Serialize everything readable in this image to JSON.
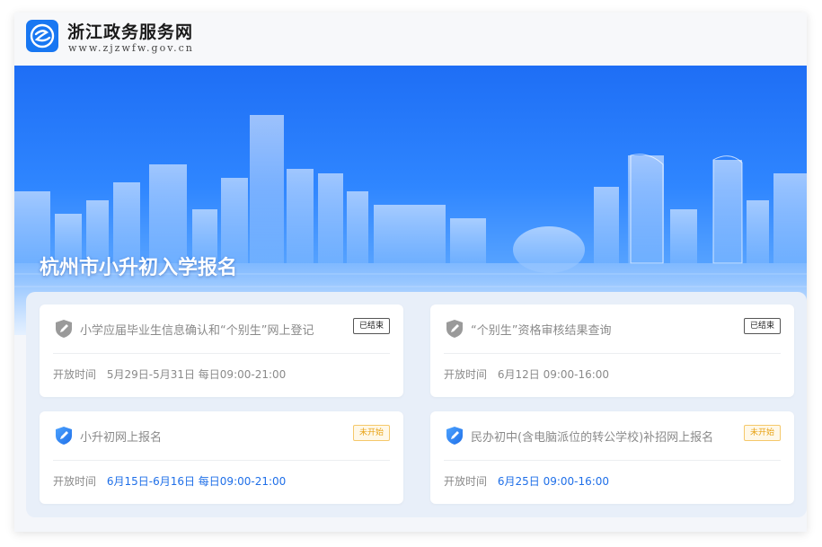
{
  "header": {
    "site_name": "浙江政务服务网",
    "site_url": "www.zjzwfw.gov.cn"
  },
  "banner": {
    "title": "杭州市小升初入学报名"
  },
  "colors": {
    "accent": "#1f6fe8",
    "badge_ended": "#555555",
    "badge_pending": "#e8a317"
  },
  "cards": [
    {
      "title": "小学应届毕业生信息确认和“个别生”网上登记",
      "status": "已结束",
      "time_label": "开放时间",
      "time_value": "5月29日-5月31日 每日09:00-21:00",
      "icon": "pencil-shield-icon"
    },
    {
      "title": "“个别生”资格审核结果查询",
      "status": "已结束",
      "time_label": "开放时间",
      "time_value": "6月12日 09:00-16:00",
      "icon": "pencil-shield-icon"
    },
    {
      "title": "小升初网上报名",
      "status": "未开始",
      "time_label": "开放时间",
      "time_value": "6月15日-6月16日 每日09:00-21:00",
      "icon": "pencil-shield-icon"
    },
    {
      "title": "民办初中(含电脑派位的转公学校)补招网上报名",
      "status": "未开始",
      "time_label": "开放时间",
      "time_value": "6月25日 09:00-16:00",
      "icon": "pencil-shield-icon"
    }
  ]
}
